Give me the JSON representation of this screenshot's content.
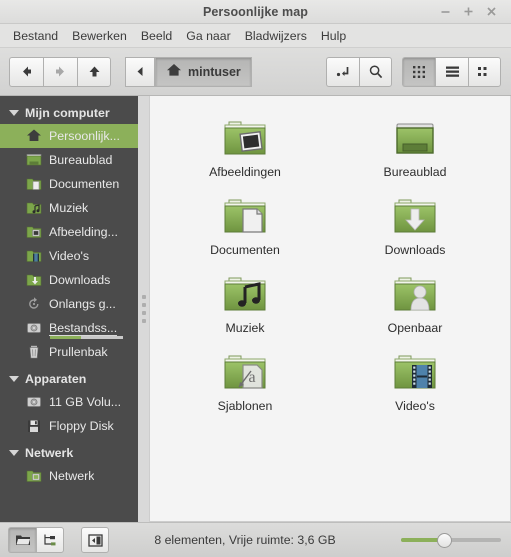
{
  "window": {
    "title": "Persoonlijke map",
    "controls": [
      {
        "name": "minimize-button",
        "glyph": "minimize"
      },
      {
        "name": "maximize-button",
        "glyph": "maximize"
      },
      {
        "name": "close-button",
        "glyph": "close"
      }
    ]
  },
  "menubar": {
    "items": [
      {
        "label": "Bestand"
      },
      {
        "label": "Bewerken"
      },
      {
        "label": "Beeld"
      },
      {
        "label": "Ga naar"
      },
      {
        "label": "Bladwijzers"
      },
      {
        "label": "Hulp"
      }
    ]
  },
  "toolbar": {
    "nav": [
      {
        "name": "back-button",
        "icon": "arrow-left-icon",
        "enabled": true
      },
      {
        "name": "forward-button",
        "icon": "arrow-right-icon",
        "enabled": false
      },
      {
        "name": "up-button",
        "icon": "arrow-up-icon",
        "enabled": true
      }
    ],
    "pathbar": {
      "scroll_left_label": "◀",
      "crumb_label": "mintuser",
      "crumb_icon": "home-icon"
    },
    "right": [
      {
        "name": "toggle-location-entry-button",
        "icon": "path-entry-icon"
      },
      {
        "name": "search-button",
        "icon": "search-icon"
      }
    ],
    "views": [
      {
        "name": "icon-view-button",
        "icon": "grid-view-icon",
        "active": true
      },
      {
        "name": "list-view-button",
        "icon": "list-view-icon",
        "active": false
      },
      {
        "name": "compact-view-button",
        "icon": "compact-view-icon",
        "active": false
      }
    ]
  },
  "sidebar": {
    "sections": [
      {
        "header": "Mijn computer",
        "items": [
          {
            "label": "Persoonlijk...",
            "icon": "home-icon",
            "selected": true
          },
          {
            "label": "Bureaublad",
            "icon": "desktop-folder-icon",
            "selected": false
          },
          {
            "label": "Documenten",
            "icon": "documents-folder-icon",
            "selected": false
          },
          {
            "label": "Muziek",
            "icon": "music-folder-icon",
            "selected": false
          },
          {
            "label": "Afbeelding...",
            "icon": "pictures-folder-icon",
            "selected": false
          },
          {
            "label": "Video's",
            "icon": "videos-folder-icon",
            "selected": false
          },
          {
            "label": "Downloads",
            "icon": "downloads-folder-icon",
            "selected": false
          },
          {
            "label": "Onlangs g...",
            "icon": "recent-icon",
            "selected": false
          },
          {
            "label": "Bestandss...",
            "icon": "harddisk-icon",
            "selected": false,
            "underlined": true,
            "usage_percent": 42
          },
          {
            "label": "Prullenbak",
            "icon": "trash-icon",
            "selected": false
          }
        ]
      },
      {
        "header": "Apparaten",
        "items": [
          {
            "label": "11 GB Volu...",
            "icon": "harddisk-icon",
            "selected": false
          },
          {
            "label": "Floppy Disk",
            "icon": "floppy-icon",
            "selected": false
          }
        ]
      },
      {
        "header": "Netwerk",
        "items": [
          {
            "label": "Netwerk",
            "icon": "network-folder-icon",
            "selected": false
          }
        ]
      }
    ]
  },
  "files": [
    {
      "label": "Afbeeldingen",
      "icon": "pictures-folder-icon"
    },
    {
      "label": "Bureaublad",
      "icon": "desktop-folder-icon"
    },
    {
      "label": "Documenten",
      "icon": "documents-folder-icon"
    },
    {
      "label": "Downloads",
      "icon": "downloads-folder-icon"
    },
    {
      "label": "Muziek",
      "icon": "music-folder-icon"
    },
    {
      "label": "Openbaar",
      "icon": "public-folder-icon"
    },
    {
      "label": "Sjablonen",
      "icon": "templates-folder-icon"
    },
    {
      "label": "Video's",
      "icon": "videos-folder-icon"
    }
  ],
  "statusbar": {
    "buttons": [
      {
        "name": "places-sidebar-button",
        "icon": "folder-icon",
        "active": true
      },
      {
        "name": "treeview-sidebar-button",
        "icon": "tree-icon",
        "active": false
      },
      {
        "name": "toggle-sidebar-button",
        "icon": "sidebar-toggle-icon",
        "active": false
      }
    ],
    "text": "8 elementen, Vrije ruimte: 3,6 GB",
    "zoom_percent": 40
  },
  "colors": {
    "accent_green": "#8cb05a",
    "sidebar_bg": "#4b4b4b",
    "content_bg": "#f4f4f4",
    "chrome_bg": "#d6d6d6"
  }
}
